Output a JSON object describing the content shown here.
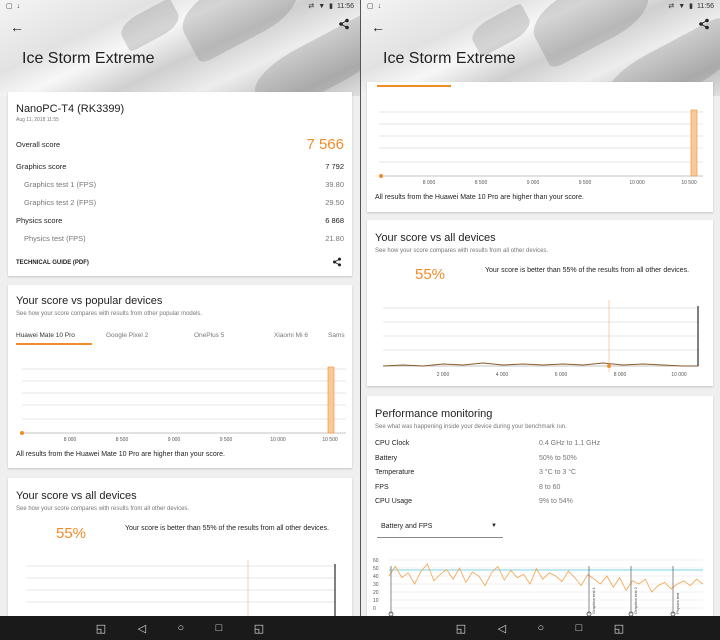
{
  "status": {
    "time": "11:56"
  },
  "page_title": "Ice Storm Extreme",
  "device": {
    "name": "NanoPC-T4 (RK3399)",
    "date": "Aug 11, 2018 11:55"
  },
  "scores": {
    "overall_label": "Overall score",
    "overall_value": "7 566",
    "graphics_label": "Graphics score",
    "graphics_value": "7 792",
    "gt1_label": "Graphics test 1 (FPS)",
    "gt1_value": "39.80",
    "gt2_label": "Graphics test 2 (FPS)",
    "gt2_value": "29.50",
    "physics_label": "Physics score",
    "physics_value": "6 868",
    "pt_label": "Physics test (FPS)",
    "pt_value": "21.80"
  },
  "tech_guide": "TECHNICAL GUIDE (PDF)",
  "popular": {
    "title": "Your score vs popular devices",
    "subtitle": "See how your score compares with results from other popular models.",
    "tabs": [
      "Huawei Mate 10 Pro",
      "Google Pixel 2",
      "OnePlus 5",
      "Xiaomi Mi 6",
      "Sams"
    ],
    "note": "All results from the Huawei Mate 10 Pro are higher than your score."
  },
  "all_devices": {
    "title": "Your score vs all devices",
    "subtitle": "See how your score compares with results from all other devices.",
    "percent": "55%",
    "text": "Your score is better than 55% of the results from all other devices."
  },
  "performance": {
    "title": "Performance monitoring",
    "subtitle": "See what was happening inside your device during your benchmark run.",
    "rows": [
      {
        "label": "CPU Clock",
        "value": "0.4 GHz to 1.1 GHz"
      },
      {
        "label": "Battery",
        "value": "50% to 50%"
      },
      {
        "label": "Temperature",
        "value": "3 °C to 3 °C"
      },
      {
        "label": "FPS",
        "value": "8 to 60"
      },
      {
        "label": "CPU Usage",
        "value": "9% to 54%"
      }
    ],
    "dropdown": "Battery and FPS",
    "y_ticks": [
      "60",
      "50",
      "40",
      "30",
      "20",
      "10",
      "0"
    ],
    "markers": [
      "Graphics test 1",
      "Graphics test 2",
      "Physics test"
    ]
  },
  "chart_data": [
    {
      "type": "bar",
      "x_ticks": [
        "8 000",
        "8 500",
        "9 000",
        "9 500",
        "10 000",
        "10 500"
      ],
      "your_score": 7566,
      "device_score": 10500
    },
    {
      "type": "bar",
      "x_ticks": [
        "2 000",
        "4 000",
        "6 000",
        "8 000",
        "10 000"
      ],
      "marker_percent": 55
    }
  ],
  "colors": {
    "accent": "#f28c28",
    "cyan": "#7fd3e6"
  }
}
